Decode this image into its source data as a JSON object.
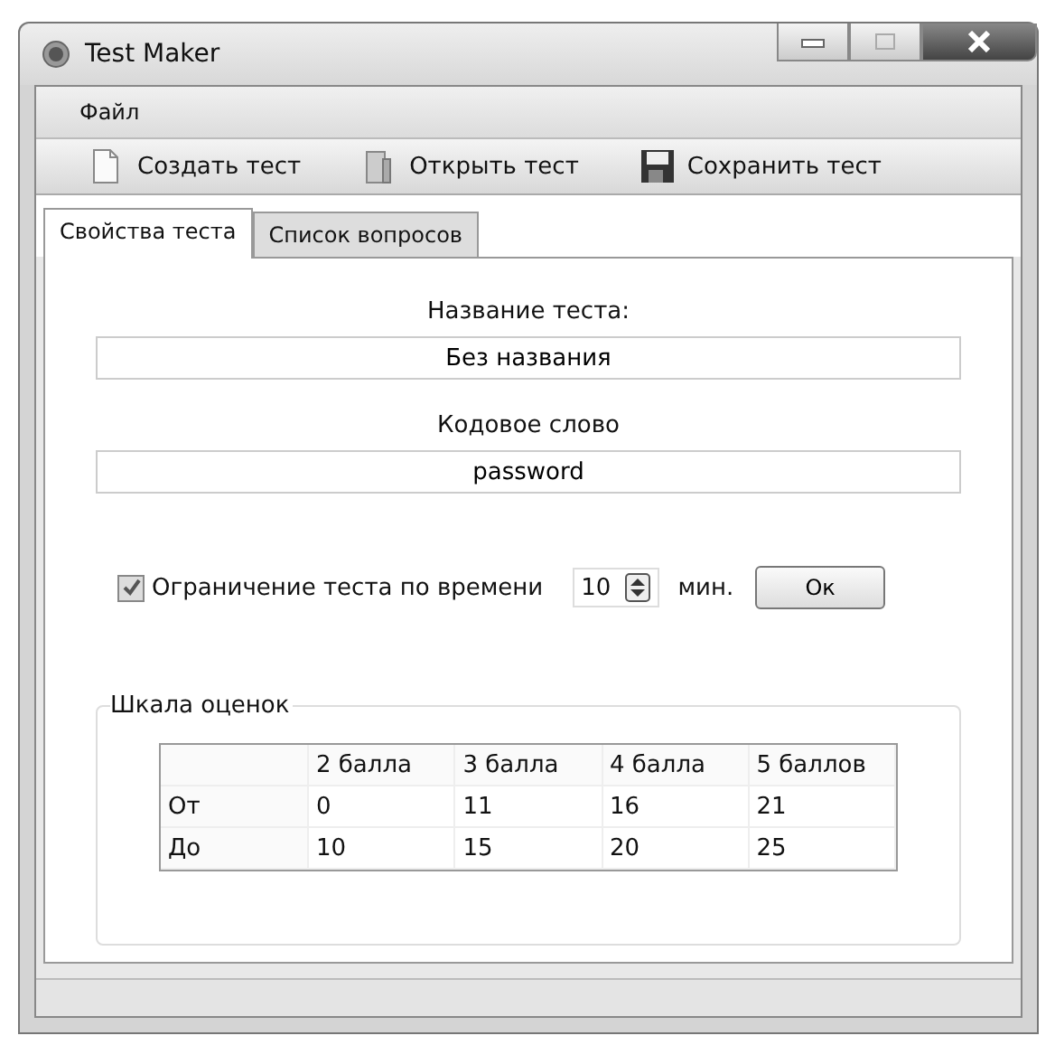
{
  "window": {
    "title": "Test Maker"
  },
  "menu": [
    {
      "label": "Файл"
    }
  ],
  "toolbar": [
    {
      "label": "Создать тест",
      "kind": "new"
    },
    {
      "label": "Открыть тест",
      "kind": "open"
    },
    {
      "label": "Сохранить тест",
      "kind": "save"
    }
  ],
  "tabs": [
    {
      "label": "Свойства теста",
      "selected": true
    },
    {
      "label": "Список вопросов",
      "selected": false
    }
  ],
  "fields": [
    {
      "label": "Название теста:",
      "value": "Без названия"
    },
    {
      "label": "Кодовое слово",
      "value": "password"
    }
  ],
  "time_limit": {
    "label": "Ограничение теста по времени",
    "checked": true,
    "value": "10",
    "unit": "мин.",
    "button": "Ок"
  },
  "grades": {
    "title": "Шкала оценок",
    "columns": [
      "2 балла",
      "3 балла",
      "4 балла",
      "5 баллов"
    ],
    "rows": [
      {
        "label": "От",
        "cells": [
          "0",
          "11",
          "16",
          "21"
        ]
      },
      {
        "label": "До",
        "cells": [
          "10",
          "15",
          "20",
          "25"
        ]
      }
    ]
  }
}
